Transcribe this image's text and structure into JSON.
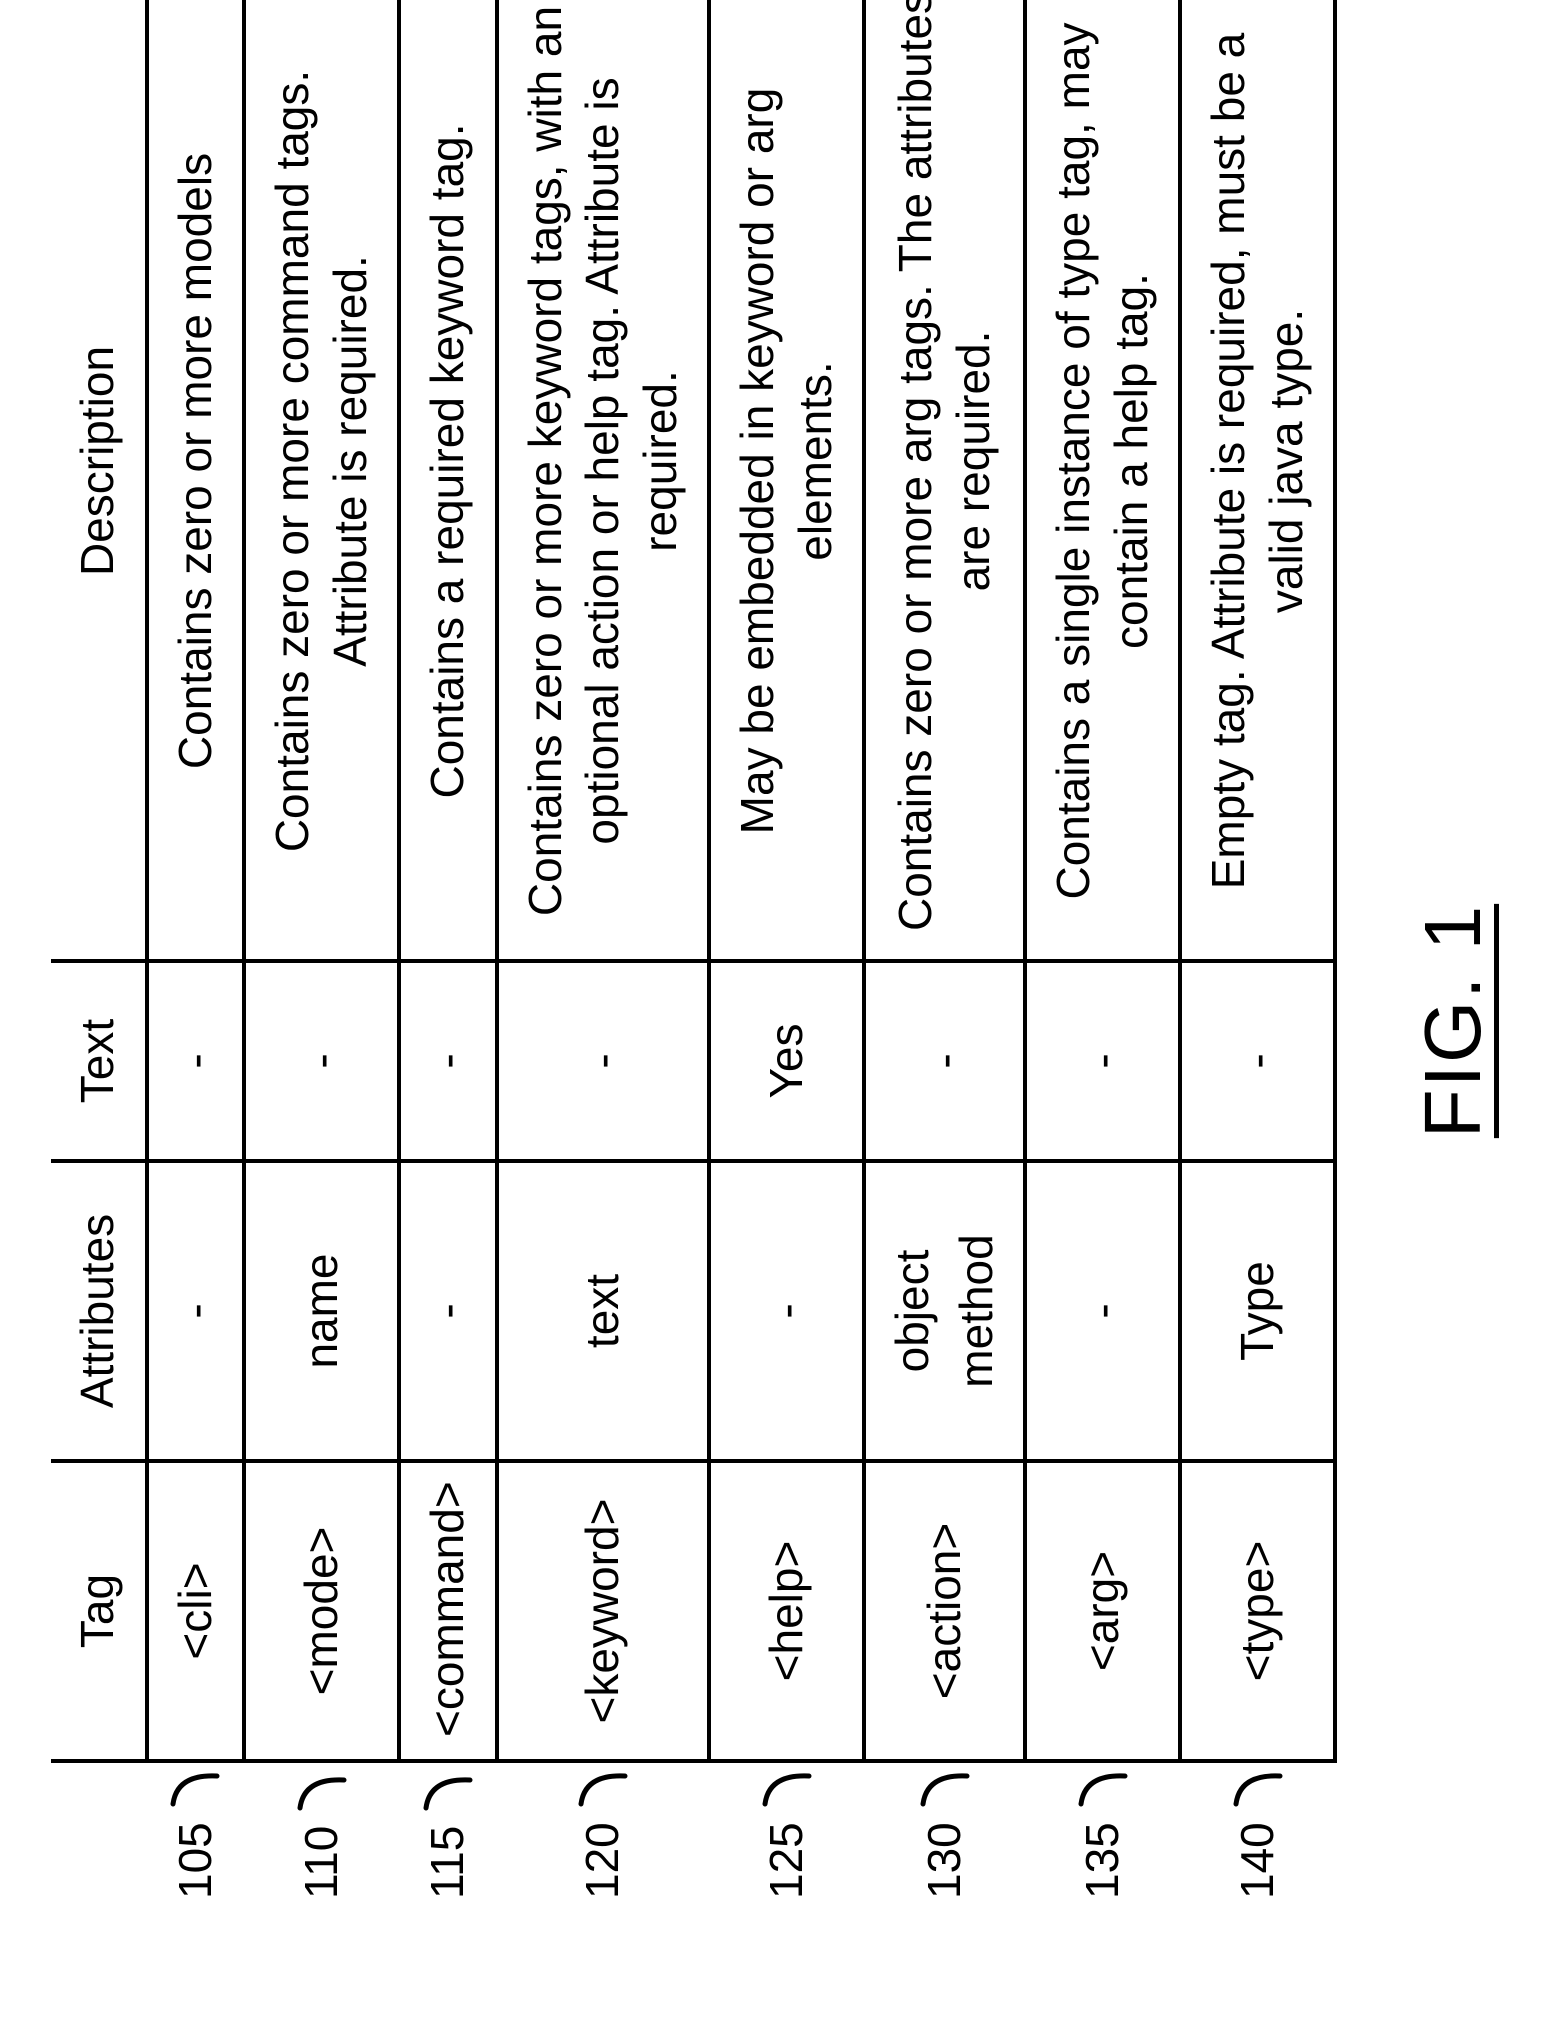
{
  "caption": "FIG. 1",
  "headers": {
    "tag": "Tag",
    "attributes": "Attributes",
    "text": "Text",
    "description": "Description"
  },
  "rows": [
    {
      "ref": "105",
      "tag": "<cli>",
      "attributes": "-",
      "text": "-",
      "description": "Contains zero or more models"
    },
    {
      "ref": "110",
      "tag": "<mode>",
      "attributes": "name",
      "text": "-",
      "description": "Contains zero or more command tags. Attribute is required."
    },
    {
      "ref": "115",
      "tag": "<command>",
      "attributes": "-",
      "text": "-",
      "description": "Contains a required keyword tag."
    },
    {
      "ref": "120",
      "tag": "<keyword>",
      "attributes": "text",
      "text": "-",
      "description": "Contains zero or more keyword tags, with an optional action or help tag. Attribute is required."
    },
    {
      "ref": "125",
      "tag": "<help>",
      "attributes": "-",
      "text": "Yes",
      "description": "May be embedded in keyword or arg elements."
    },
    {
      "ref": "130",
      "tag": "<action>",
      "attributes": "object\nmethod",
      "text": "-",
      "description": "Contains zero or more arg tags. The attributes are required."
    },
    {
      "ref": "135",
      "tag": "<arg>",
      "attributes": "-",
      "text": "-",
      "description": "Contains a single instance of type tag, may contain a help tag."
    },
    {
      "ref": "140",
      "tag": "<type>",
      "attributes": "Type",
      "text": "-",
      "description": "Empty tag. Attribute is required, must be a valid java type."
    }
  ],
  "chart_data": {
    "type": "table",
    "title": "FIG. 1",
    "columns": [
      "Tag",
      "Attributes",
      "Text",
      "Description"
    ],
    "row_refs": [
      "105",
      "110",
      "115",
      "120",
      "125",
      "130",
      "135",
      "140"
    ],
    "rows": [
      [
        "<cli>",
        "-",
        "-",
        "Contains zero or more models"
      ],
      [
        "<mode>",
        "name",
        "-",
        "Contains zero or more command tags. Attribute is required."
      ],
      [
        "<command>",
        "-",
        "-",
        "Contains a required keyword tag."
      ],
      [
        "<keyword>",
        "text",
        "-",
        "Contains zero or more keyword tags, with an optional action or help tag. Attribute is required."
      ],
      [
        "<help>",
        "-",
        "Yes",
        "May be embedded in keyword or arg elements."
      ],
      [
        "<action>",
        "object; method",
        "-",
        "Contains zero or more arg tags. The attributes are required."
      ],
      [
        "<arg>",
        "-",
        "-",
        "Contains a single instance of type tag, may contain a help tag."
      ],
      [
        "<type>",
        "Type",
        "-",
        "Empty tag. Attribute is required, must be a valid java type."
      ]
    ]
  }
}
